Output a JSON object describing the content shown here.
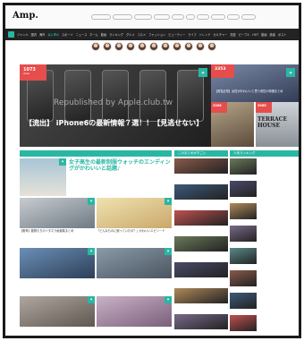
{
  "logo": "Amp.",
  "pills": [
    "",
    "",
    "",
    "",
    "",
    "",
    "",
    "",
    "",
    ""
  ],
  "nav": {
    "items": [
      "ジャンル",
      "国内",
      "海外",
      "エンタメ",
      "スポーツ",
      "ニュース",
      "ホーム",
      "動画",
      "ランキング",
      "グルメ",
      "コスメ",
      "ファッション",
      "ビューティー",
      "ライフ",
      "トレンド",
      "カルチャー",
      "恋愛",
      "ピープル",
      "HOT",
      "動画",
      "読者",
      "ポスト"
    ],
    "highlight_index": 3
  },
  "avatars_count": 11,
  "hero": {
    "views": "1073",
    "views_unit": "views",
    "watermark": "Republished by Apple.club.tw",
    "title": "【流出】 iPhone6の最新情報７選！！【見逃せない】"
  },
  "side_hero": {
    "views": "3353",
    "title": "【男性必見】女性がかわいいと思う男性の特徴まとめ",
    "views2": "2308",
    "views3": "3065",
    "label3": "TERRACE HOUSE"
  },
  "sections": {
    "news_label": "",
    "pickup_label": "このまとめがすごい",
    "ranking_label": "人気ランキング"
  },
  "articles": {
    "feature_title": "女子高生の最新制服ウォッチのエンディングがかわいいと話題♪",
    "feature_excerpt": "",
    "a1": "【衝撃】動物たちのイタズラ画像集まとめ",
    "a2": "「どんなものに使っていたの？」かわいいエピソード",
    "a3": "",
    "a4": "",
    "a5": "",
    "a6": ""
  },
  "pickup": [
    "",
    "",
    "",
    "",
    "",
    "",
    ""
  ],
  "ranking": [
    "",
    "",
    "",
    "",
    "",
    "",
    "",
    ""
  ]
}
